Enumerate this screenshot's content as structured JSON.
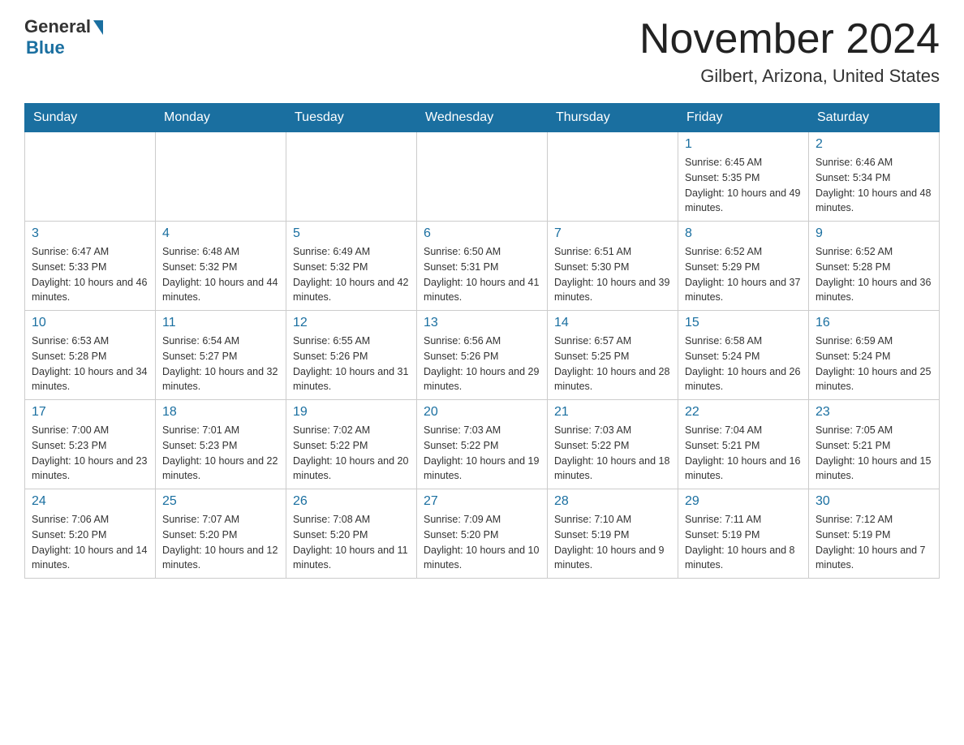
{
  "logo": {
    "general": "General",
    "blue": "Blue"
  },
  "header": {
    "month_title": "November 2024",
    "location": "Gilbert, Arizona, United States"
  },
  "days_of_week": [
    "Sunday",
    "Monday",
    "Tuesday",
    "Wednesday",
    "Thursday",
    "Friday",
    "Saturday"
  ],
  "weeks": [
    [
      {
        "day": "",
        "info": ""
      },
      {
        "day": "",
        "info": ""
      },
      {
        "day": "",
        "info": ""
      },
      {
        "day": "",
        "info": ""
      },
      {
        "day": "",
        "info": ""
      },
      {
        "day": "1",
        "info": "Sunrise: 6:45 AM\nSunset: 5:35 PM\nDaylight: 10 hours and 49 minutes."
      },
      {
        "day": "2",
        "info": "Sunrise: 6:46 AM\nSunset: 5:34 PM\nDaylight: 10 hours and 48 minutes."
      }
    ],
    [
      {
        "day": "3",
        "info": "Sunrise: 6:47 AM\nSunset: 5:33 PM\nDaylight: 10 hours and 46 minutes."
      },
      {
        "day": "4",
        "info": "Sunrise: 6:48 AM\nSunset: 5:32 PM\nDaylight: 10 hours and 44 minutes."
      },
      {
        "day": "5",
        "info": "Sunrise: 6:49 AM\nSunset: 5:32 PM\nDaylight: 10 hours and 42 minutes."
      },
      {
        "day": "6",
        "info": "Sunrise: 6:50 AM\nSunset: 5:31 PM\nDaylight: 10 hours and 41 minutes."
      },
      {
        "day": "7",
        "info": "Sunrise: 6:51 AM\nSunset: 5:30 PM\nDaylight: 10 hours and 39 minutes."
      },
      {
        "day": "8",
        "info": "Sunrise: 6:52 AM\nSunset: 5:29 PM\nDaylight: 10 hours and 37 minutes."
      },
      {
        "day": "9",
        "info": "Sunrise: 6:52 AM\nSunset: 5:28 PM\nDaylight: 10 hours and 36 minutes."
      }
    ],
    [
      {
        "day": "10",
        "info": "Sunrise: 6:53 AM\nSunset: 5:28 PM\nDaylight: 10 hours and 34 minutes."
      },
      {
        "day": "11",
        "info": "Sunrise: 6:54 AM\nSunset: 5:27 PM\nDaylight: 10 hours and 32 minutes."
      },
      {
        "day": "12",
        "info": "Sunrise: 6:55 AM\nSunset: 5:26 PM\nDaylight: 10 hours and 31 minutes."
      },
      {
        "day": "13",
        "info": "Sunrise: 6:56 AM\nSunset: 5:26 PM\nDaylight: 10 hours and 29 minutes."
      },
      {
        "day": "14",
        "info": "Sunrise: 6:57 AM\nSunset: 5:25 PM\nDaylight: 10 hours and 28 minutes."
      },
      {
        "day": "15",
        "info": "Sunrise: 6:58 AM\nSunset: 5:24 PM\nDaylight: 10 hours and 26 minutes."
      },
      {
        "day": "16",
        "info": "Sunrise: 6:59 AM\nSunset: 5:24 PM\nDaylight: 10 hours and 25 minutes."
      }
    ],
    [
      {
        "day": "17",
        "info": "Sunrise: 7:00 AM\nSunset: 5:23 PM\nDaylight: 10 hours and 23 minutes."
      },
      {
        "day": "18",
        "info": "Sunrise: 7:01 AM\nSunset: 5:23 PM\nDaylight: 10 hours and 22 minutes."
      },
      {
        "day": "19",
        "info": "Sunrise: 7:02 AM\nSunset: 5:22 PM\nDaylight: 10 hours and 20 minutes."
      },
      {
        "day": "20",
        "info": "Sunrise: 7:03 AM\nSunset: 5:22 PM\nDaylight: 10 hours and 19 minutes."
      },
      {
        "day": "21",
        "info": "Sunrise: 7:03 AM\nSunset: 5:22 PM\nDaylight: 10 hours and 18 minutes."
      },
      {
        "day": "22",
        "info": "Sunrise: 7:04 AM\nSunset: 5:21 PM\nDaylight: 10 hours and 16 minutes."
      },
      {
        "day": "23",
        "info": "Sunrise: 7:05 AM\nSunset: 5:21 PM\nDaylight: 10 hours and 15 minutes."
      }
    ],
    [
      {
        "day": "24",
        "info": "Sunrise: 7:06 AM\nSunset: 5:20 PM\nDaylight: 10 hours and 14 minutes."
      },
      {
        "day": "25",
        "info": "Sunrise: 7:07 AM\nSunset: 5:20 PM\nDaylight: 10 hours and 12 minutes."
      },
      {
        "day": "26",
        "info": "Sunrise: 7:08 AM\nSunset: 5:20 PM\nDaylight: 10 hours and 11 minutes."
      },
      {
        "day": "27",
        "info": "Sunrise: 7:09 AM\nSunset: 5:20 PM\nDaylight: 10 hours and 10 minutes."
      },
      {
        "day": "28",
        "info": "Sunrise: 7:10 AM\nSunset: 5:19 PM\nDaylight: 10 hours and 9 minutes."
      },
      {
        "day": "29",
        "info": "Sunrise: 7:11 AM\nSunset: 5:19 PM\nDaylight: 10 hours and 8 minutes."
      },
      {
        "day": "30",
        "info": "Sunrise: 7:12 AM\nSunset: 5:19 PM\nDaylight: 10 hours and 7 minutes."
      }
    ]
  ]
}
